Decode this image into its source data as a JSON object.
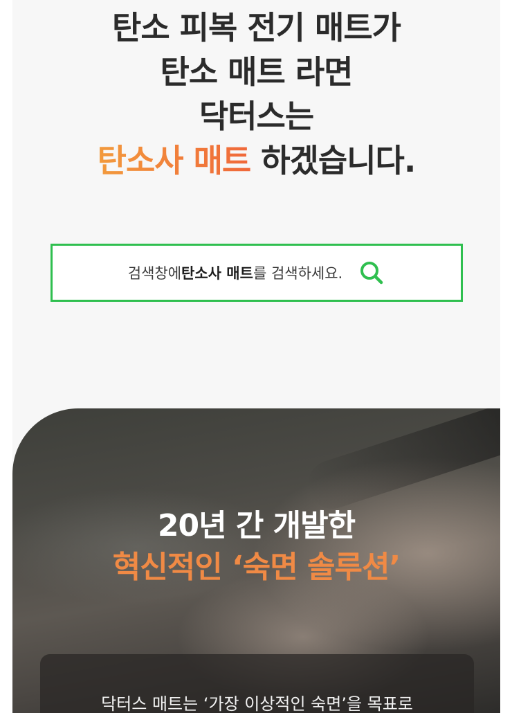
{
  "headline": {
    "line1": "탄소 피복 전기 매트가",
    "line2": "탄소 매트 라면",
    "line3": "닥터스는",
    "line4_accent": "탄소사 매트",
    "line4_rest": " 하겠습니다."
  },
  "search": {
    "prefix": "검색창에 ",
    "keyword": "탄소사 매트",
    "suffix": "를 검색하세요.",
    "icon": "search-icon",
    "border_color": "#2fbf4f"
  },
  "hero": {
    "title_line1": "20년 간 개발한",
    "title_line2": "혁신적인 ‘숙면 솔루션’",
    "card_text": "닥터스 매트는 ‘가장 이상적인 숙면’을 목표로",
    "accent_color": "#f08a45"
  }
}
